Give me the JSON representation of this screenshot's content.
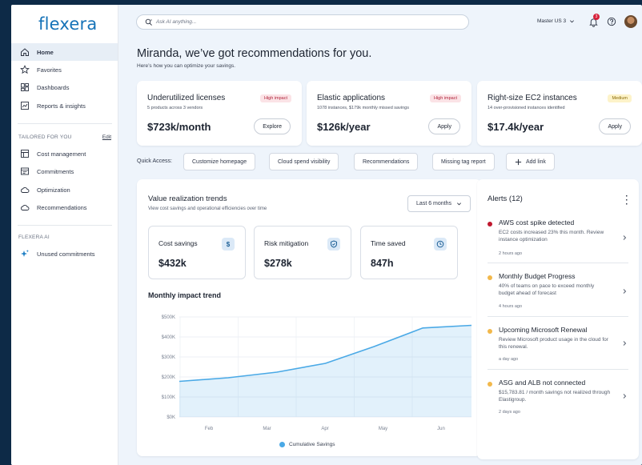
{
  "brand": {
    "name": "flexera"
  },
  "sidebar": {
    "items": [
      {
        "label": "Home",
        "icon": "home-icon"
      },
      {
        "label": "Favorites",
        "icon": "star-icon"
      },
      {
        "label": "Dashboards",
        "icon": "dashboard-icon"
      },
      {
        "label": "Reports & insights",
        "icon": "reports-icon"
      }
    ],
    "tailored_section": "TAILORED FOR YOU",
    "edit_label": "Edit",
    "tailored_items": [
      {
        "label": "Cost management",
        "icon": "cost-icon"
      },
      {
        "label": "Commitments",
        "icon": "commitments-icon"
      },
      {
        "label": "Optimization",
        "icon": "cloud-icon"
      },
      {
        "label": "Recommendations",
        "icon": "cloud-icon"
      }
    ],
    "ai_section": "FLEXERA AI",
    "ai_items": [
      {
        "label": "Unused commitments",
        "icon": "sparkle-icon"
      }
    ]
  },
  "header": {
    "search_placeholder": "Ask AI anything...",
    "account": "Master US 3",
    "notification_count": "3"
  },
  "greeting": {
    "title": "Miranda, we’ve got recommendations for you.",
    "subtitle": "Here’s how you can optimize your savings."
  },
  "recommendations": [
    {
      "title": "Underutilized licenses",
      "subtitle": "5 products across 3 vendors",
      "value": "$723k/month",
      "action": "Explore",
      "impact": "High impact"
    },
    {
      "title": "Elastic applications",
      "subtitle": "1078 instances, $179k monthly missed savings",
      "value": "$126k/year",
      "action": "Apply",
      "impact": "High impact"
    },
    {
      "title": "Right-size EC2 instances",
      "subtitle": "14 over-provisioned instances identified",
      "value": "$17.4k/year",
      "action": "Apply",
      "impact": "Medium"
    }
  ],
  "quick_access": {
    "label": "Quick Access:",
    "links": [
      "Customize homepage",
      "Cloud spend visibility",
      "Recommendations",
      "Missing tag report"
    ],
    "add_label": "Add link"
  },
  "value_panel": {
    "title": "Value realization trends",
    "subtitle": "View cost savings and operational efficiencies over time",
    "range": "Last 6 months",
    "metrics": [
      {
        "label": "Cost savings",
        "value": "$432k",
        "icon": "dollar-icon"
      },
      {
        "label": "Risk mitigation",
        "value": "$278k",
        "icon": "shield-icon"
      },
      {
        "label": "Time saved",
        "value": "847h",
        "icon": "clock-icon"
      }
    ],
    "chart_title": "Monthly impact trend",
    "accent": "#4aa9e6"
  },
  "chart_data": {
    "type": "area",
    "title": "Monthly impact trend",
    "x": [
      "Feb",
      "Mar",
      "Apr",
      "May",
      "Jun"
    ],
    "points": [
      {
        "x": "Jan-end",
        "y": 178
      },
      {
        "x": "Feb",
        "y": 196
      },
      {
        "x": "Mar",
        "y": 224
      },
      {
        "x": "Apr",
        "y": 268
      },
      {
        "x": "May",
        "y": 352
      },
      {
        "x": "Jun",
        "y": 445
      },
      {
        "x": "Jun-end",
        "y": 458
      }
    ],
    "series": [
      {
        "name": "Cumulative Savings",
        "values": [
          178,
          196,
          224,
          268,
          352,
          445,
          458
        ]
      }
    ],
    "y_ticks": [
      "$0K",
      "$100K",
      "$200K",
      "$300K",
      "$400K",
      "$500K"
    ],
    "ylim": [
      0,
      500
    ],
    "grid": true,
    "legend": "bottom-center"
  },
  "alerts": {
    "title": "Alerts (12)",
    "items": [
      {
        "title": "AWS cost spike detected",
        "body": "EC2 costs increased 23% this month. Review instance optimization",
        "time": "2 hours ago",
        "color": "#c0182f"
      },
      {
        "title": "Monthly Budget Progress",
        "body": "40% of teams on pace to exceed monthly budget ahead of forecast",
        "time": "4 hours ago",
        "color": "#f2b84b"
      },
      {
        "title": "Upcoming Microsoft Renewal",
        "body": "Review Microsoft product usage in the cloud for this renewal.",
        "time": "a day ago",
        "color": "#f2b84b"
      },
      {
        "title": "ASG and ALB not connected",
        "body": "$15,783.81 / month savings not realized through Elastigroup.",
        "time": "2 days ago",
        "color": "#f2b84b"
      }
    ]
  }
}
